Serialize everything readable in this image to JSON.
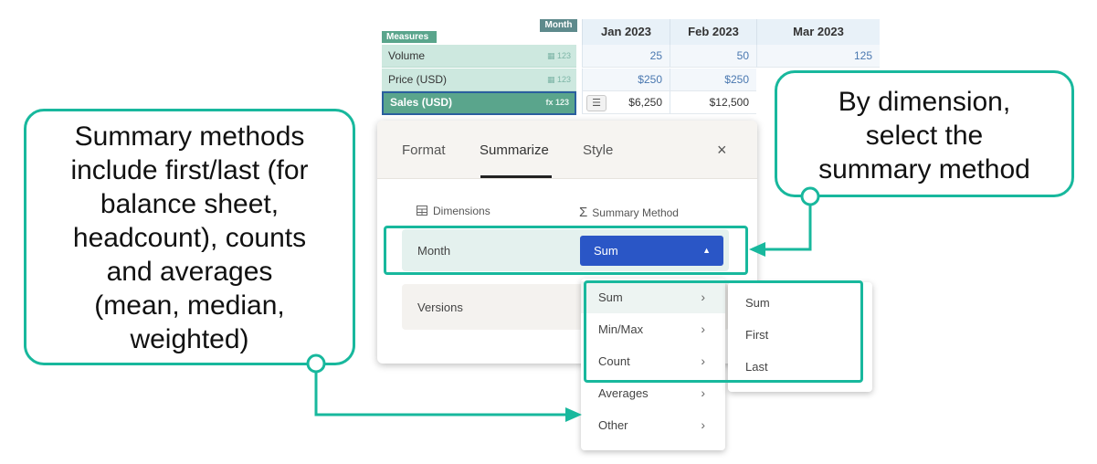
{
  "grid": {
    "month_chip": "Month",
    "measures_chip": "Measures",
    "columns": [
      "Jan 2023",
      "Feb 2023",
      "Mar 2023"
    ],
    "rows": [
      {
        "label": "Volume",
        "tag": "▦ 123",
        "values": [
          "25",
          "50",
          "125"
        ]
      },
      {
        "label": "Price (USD)",
        "tag": "▦ 123",
        "values": [
          "$250",
          "$250",
          ""
        ]
      },
      {
        "label": "Sales (USD)",
        "tag": "fx 123",
        "values": [
          "$6,250",
          "$12,500",
          ""
        ]
      }
    ],
    "summary_button": "☰"
  },
  "panel": {
    "tabs": [
      "Format",
      "Summarize",
      "Style"
    ],
    "active_tab": "Summarize",
    "close_icon": "×",
    "dimensions_label": "Dimensions",
    "summary_method_label": "Summary Method",
    "dimensions": [
      {
        "label": "Month",
        "method": "Sum"
      },
      {
        "label": "Versions"
      }
    ]
  },
  "menu": {
    "items": [
      "Sum",
      "Min/Max",
      "Count",
      "Averages",
      "Other"
    ],
    "highlighted": "Sum"
  },
  "submenu": {
    "items": [
      "Sum",
      "First",
      "Last"
    ]
  },
  "callouts": {
    "left": [
      "Summary methods",
      "include first/last (for",
      "balance sheet,",
      "headcount), counts",
      "and averages",
      "(mean, median,",
      "weighted)"
    ],
    "right": [
      "By dimension,",
      "select the",
      "summary method"
    ]
  },
  "colors": {
    "accent_teal": "#18b89d",
    "select_blue": "#2a56c6",
    "measure_green": "#5aa58c"
  }
}
